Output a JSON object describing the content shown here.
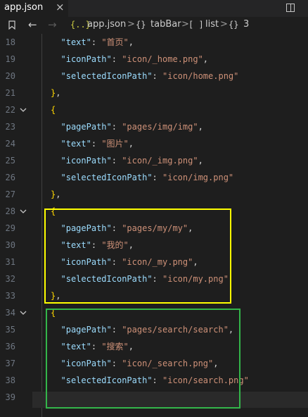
{
  "tab": {
    "label": "app.json",
    "close": "×"
  },
  "breadcrumb": {
    "file": "app.json",
    "items": [
      {
        "icon": "{}",
        "label": "tabBar"
      },
      {
        "icon": "[ ]",
        "label": "list"
      },
      {
        "icon": "{}",
        "label": "3"
      }
    ],
    "separator": ">"
  },
  "editor": {
    "current_line": 39,
    "lines": [
      {
        "n": "18",
        "indent": 2,
        "tokens": [
          [
            "k",
            "\"text\""
          ],
          [
            "p",
            ": "
          ],
          [
            "s",
            "\"首页\""
          ],
          [
            "p",
            ","
          ]
        ]
      },
      {
        "n": "19",
        "indent": 2,
        "tokens": [
          [
            "k",
            "\"iconPath\""
          ],
          [
            "p",
            ": "
          ],
          [
            "s",
            "\"icon/_home.png\""
          ],
          [
            "p",
            ","
          ]
        ]
      },
      {
        "n": "20",
        "indent": 2,
        "tokens": [
          [
            "k",
            "\"selectedIconPath\""
          ],
          [
            "p",
            ": "
          ],
          [
            "s",
            "\"icon/home.png\""
          ]
        ]
      },
      {
        "n": "21",
        "indent": 0,
        "tokens": [
          [
            "b",
            "}"
          ],
          [
            "p",
            ","
          ]
        ]
      },
      {
        "n": "22",
        "indent": 0,
        "fold": true,
        "tokens": [
          [
            "b",
            "{"
          ]
        ]
      },
      {
        "n": "23",
        "indent": 2,
        "tokens": [
          [
            "k",
            "\"pagePath\""
          ],
          [
            "p",
            ": "
          ],
          [
            "s",
            "\"pages/img/img\""
          ],
          [
            "p",
            ","
          ]
        ]
      },
      {
        "n": "24",
        "indent": 2,
        "tokens": [
          [
            "k",
            "\"text\""
          ],
          [
            "p",
            ": "
          ],
          [
            "s",
            "\"图片\""
          ],
          [
            "p",
            ","
          ]
        ]
      },
      {
        "n": "25",
        "indent": 2,
        "tokens": [
          [
            "k",
            "\"iconPath\""
          ],
          [
            "p",
            ": "
          ],
          [
            "s",
            "\"icon/_img.png\""
          ],
          [
            "p",
            ","
          ]
        ]
      },
      {
        "n": "26",
        "indent": 2,
        "tokens": [
          [
            "k",
            "\"selectedIconPath\""
          ],
          [
            "p",
            ": "
          ],
          [
            "s",
            "\"icon/img.png\""
          ]
        ]
      },
      {
        "n": "27",
        "indent": 0,
        "tokens": [
          [
            "b",
            "}"
          ],
          [
            "p",
            ","
          ]
        ]
      },
      {
        "n": "28",
        "indent": 0,
        "fold": true,
        "tokens": [
          [
            "b",
            "{"
          ]
        ]
      },
      {
        "n": "29",
        "indent": 2,
        "tokens": [
          [
            "k",
            "\"pagePath\""
          ],
          [
            "p",
            ": "
          ],
          [
            "s",
            "\"pages/my/my\""
          ],
          [
            "p",
            ","
          ]
        ]
      },
      {
        "n": "30",
        "indent": 2,
        "tokens": [
          [
            "k",
            "\"text\""
          ],
          [
            "p",
            ": "
          ],
          [
            "s",
            "\"我的\""
          ],
          [
            "p",
            ","
          ]
        ]
      },
      {
        "n": "31",
        "indent": 2,
        "tokens": [
          [
            "k",
            "\"iconPath\""
          ],
          [
            "p",
            ": "
          ],
          [
            "s",
            "\"icon/_my.png\""
          ],
          [
            "p",
            ","
          ]
        ]
      },
      {
        "n": "32",
        "indent": 2,
        "tokens": [
          [
            "k",
            "\"selectedIconPath\""
          ],
          [
            "p",
            ": "
          ],
          [
            "s",
            "\"icon/my.png\""
          ]
        ]
      },
      {
        "n": "33",
        "indent": 0,
        "tokens": [
          [
            "b",
            "}"
          ],
          [
            "p",
            ","
          ]
        ]
      },
      {
        "n": "34",
        "indent": 0,
        "fold": true,
        "tokens": [
          [
            "b",
            "{"
          ]
        ]
      },
      {
        "n": "35",
        "indent": 2,
        "tokens": [
          [
            "k",
            "\"pagePath\""
          ],
          [
            "p",
            ": "
          ],
          [
            "s",
            "\"pages/search/search\""
          ],
          [
            "p",
            ","
          ]
        ]
      },
      {
        "n": "36",
        "indent": 2,
        "tokens": [
          [
            "k",
            "\"text\""
          ],
          [
            "p",
            ": "
          ],
          [
            "s",
            "\"搜索\""
          ],
          [
            "p",
            ","
          ]
        ]
      },
      {
        "n": "37",
        "indent": 2,
        "tokens": [
          [
            "k",
            "\"iconPath\""
          ],
          [
            "p",
            ": "
          ],
          [
            "s",
            "\"icon/_search.png\""
          ],
          [
            "p",
            ","
          ]
        ]
      },
      {
        "n": "38",
        "indent": 2,
        "tokens": [
          [
            "k",
            "\"selectedIconPath\""
          ],
          [
            "p",
            ": "
          ],
          [
            "s",
            "\"icon/search.png\""
          ]
        ]
      },
      {
        "n": "39",
        "indent": 0,
        "tokens": [
          [
            "b",
            "}"
          ]
        ]
      }
    ]
  },
  "colors": {
    "background": "#1e1e1e",
    "json_key": "#9cdcfe",
    "json_string": "#ce9178",
    "bracket": "#ffd700",
    "yellow_box": "#ffff00",
    "green_box": "#33b54a"
  }
}
